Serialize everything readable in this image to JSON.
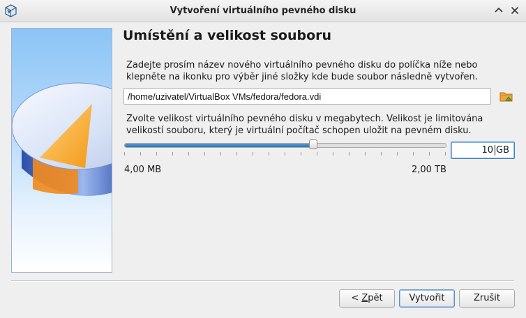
{
  "window": {
    "title": "Vytvoření virtuálního pevného disku"
  },
  "page": {
    "heading": "Umístění a velikost souboru",
    "location_description": "Zadejte prosím název nového virtuálního pevného disku do políčka níže nebo klepněte na ikonku pro výběr jiné složky kde bude soubor následně vytvořen.",
    "file_path": "/home/uzivatel/VirtualBox VMs/fedora/fedora.vdi",
    "size_description": "Zvolte velikost virtuálního pevného disku v megabytech. Velikost je limitována velikostí souboru, který je virtuální počítač schopen uložit na pevném disku.",
    "size": {
      "value": "10",
      "unit": "GB",
      "slider_fraction": 0.59,
      "min_label": "4,00 MB",
      "max_label": "2,00 TB"
    }
  },
  "buttons": {
    "back_prefix": "< ",
    "back_mnemonic": "Z",
    "back_rest": "pět",
    "create": "Vytvořit",
    "cancel": "Zrušit"
  },
  "icons": {
    "app": "virtualbox-icon",
    "maximize": "chevron-up-icon",
    "close": "close-icon",
    "folder": "folder-browse-icon",
    "side_image": "disk-pie-illustration"
  },
  "colors": {
    "accent": "#3d7fc6",
    "slider_fill": "#2d74b8"
  }
}
